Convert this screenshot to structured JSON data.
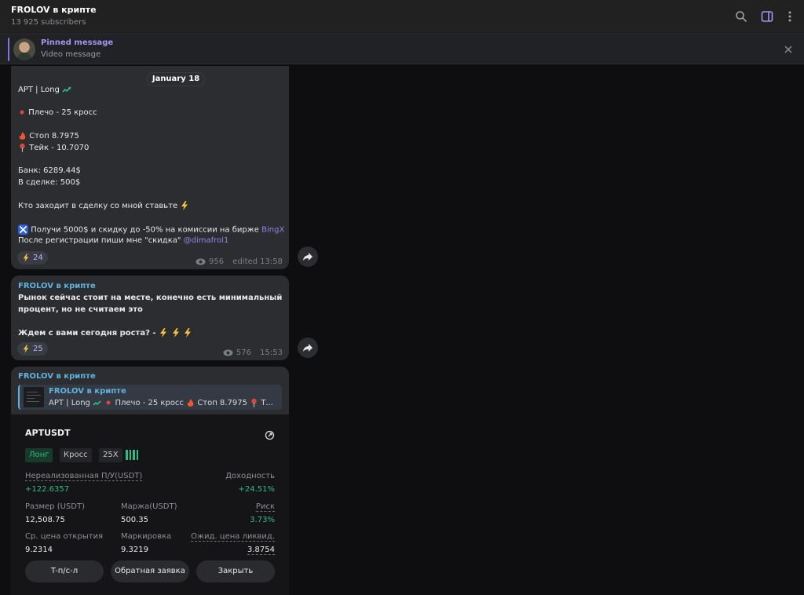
{
  "header": {
    "channel_title": "FROLOV в крипте",
    "subscribers": "13 925 subscribers"
  },
  "pinned": {
    "label": "Pinned message",
    "text": "Video message"
  },
  "date_separator": "January 18",
  "post1": {
    "line1": "APT | Long",
    "leverage": "Плечо - 25 кросс",
    "stop": "Стоп 8.7975",
    "take": "Тейк - 10.7070",
    "bank": "Банк: 6289.44$",
    "in_deal": "В сделке: 500$",
    "cta": "Кто заходит в сделку со мной ставьте",
    "promo_prefix": "Получи 5000$ и скидку до -50% на комиссии на бирже ",
    "promo_link": "BingX",
    "reg_prefix": "После регистрации пиши мне \"скидка\" ",
    "reg_link": "@dimafrol1",
    "reactions": "24",
    "views": "956",
    "time": "edited 13:58"
  },
  "post2": {
    "sender": "FROLOV в крипте",
    "line1": "Рынок сейчас стоит на месте, конечно есть минимальный",
    "line2": "процент, но не считаем это",
    "line3": "Ждем с вами сегодня роста? -",
    "reactions": "25",
    "views": "576",
    "time": "15:53"
  },
  "post3": {
    "sender": "FROLOV в крипте",
    "reply_sender": "FROLOV в крипте",
    "reply_text": "APT | Long",
    "reply_leverage": "Плечо - 25 кросс",
    "reply_stop": "Стоп 8.7975",
    "reply_more": "Т..."
  },
  "trade_card": {
    "symbol": "APTUSDT",
    "tags": [
      "Лонг",
      "Кросс",
      "25X"
    ],
    "unrealized_label": "Нереализованная П/У(USDT)",
    "unrealized_value": "+122.6357",
    "yield_label": "Доходность",
    "yield_value": "+24.51%",
    "size_label": "Размер (USDT)",
    "size_value": "12,508.75",
    "margin_label": "Маржа(USDT)",
    "margin_value": "500.35",
    "risk_label": "Риск",
    "risk_value": "3.73%",
    "entry_label": "Ср. цена открытия",
    "entry_value": "9.2314",
    "mark_label": "Маркировка",
    "mark_value": "9.3219",
    "liq_label": "Ожид. цена ликвид.",
    "liq_value": "3.8754",
    "btn_tpsl": "T-п/с-л",
    "btn_reverse": "Обратная заявка",
    "btn_close": "Закрыть"
  },
  "colors": {
    "accent": "#8774e1",
    "link": "#62b2e0",
    "profit": "#2ebd85",
    "bubble": "#2b2d31"
  }
}
